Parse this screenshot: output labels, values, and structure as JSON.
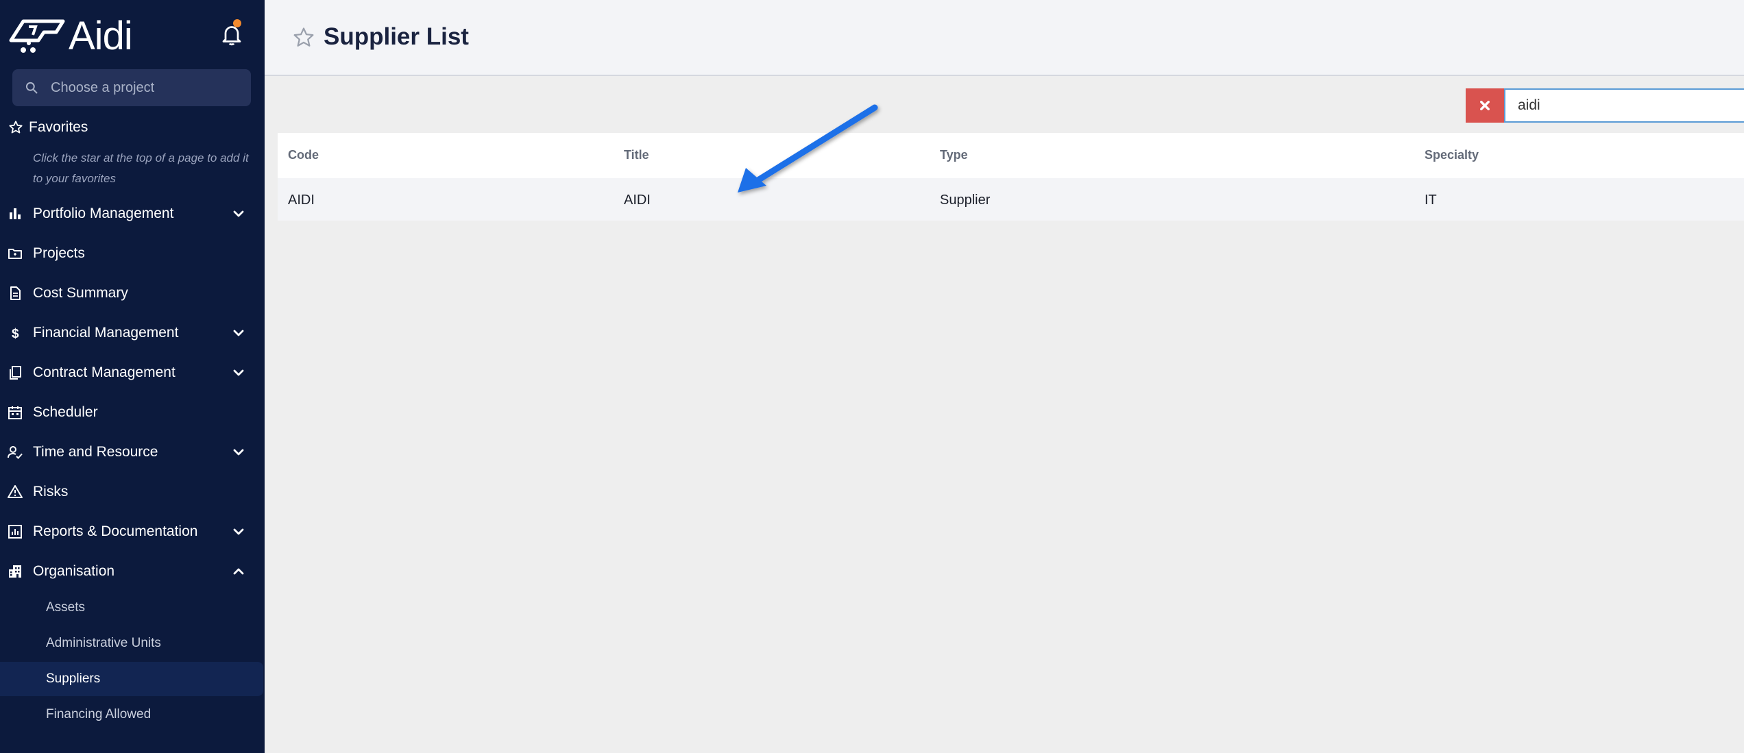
{
  "app": {
    "name": "Aidi"
  },
  "sidebar": {
    "project_search_placeholder": "Choose a project",
    "favorites_title": "Favorites",
    "favorites_hint": "Click the star at the top of a page to add it to your favorites",
    "items": [
      {
        "label": "Portfolio Management",
        "icon": "bar-chart-icon",
        "expandable": true
      },
      {
        "label": "Projects",
        "icon": "folder-icon",
        "expandable": false
      },
      {
        "label": "Cost Summary",
        "icon": "document-icon",
        "expandable": false
      },
      {
        "label": "Financial Management",
        "icon": "dollar-icon",
        "expandable": true
      },
      {
        "label": "Contract Management",
        "icon": "copy-icon",
        "expandable": true
      },
      {
        "label": "Scheduler",
        "icon": "calendar-icon",
        "expandable": false
      },
      {
        "label": "Time and Resource",
        "icon": "user-check-icon",
        "expandable": true
      },
      {
        "label": "Risks",
        "icon": "warning-icon",
        "expandable": false
      },
      {
        "label": "Reports & Documentation",
        "icon": "report-icon",
        "expandable": true
      },
      {
        "label": "Organisation",
        "icon": "building-icon",
        "expandable": true,
        "expanded": true
      }
    ],
    "sub_items": [
      {
        "label": "Assets"
      },
      {
        "label": "Administrative Units"
      },
      {
        "label": "Suppliers",
        "active": true
      },
      {
        "label": "Financing Allowed"
      }
    ]
  },
  "header": {
    "title": "Supplier List"
  },
  "search": {
    "value": "aidi"
  },
  "table": {
    "columns": [
      "Code",
      "Title",
      "Type",
      "Specialty"
    ],
    "rows": [
      [
        "AIDI",
        "AIDI",
        "Supplier",
        "IT"
      ]
    ]
  },
  "colors": {
    "sidebar_bg": "#0c1a3d",
    "accent_clear": "#d9534f",
    "notification_dot": "#f28a2e",
    "arrow": "#1e6fe8"
  }
}
